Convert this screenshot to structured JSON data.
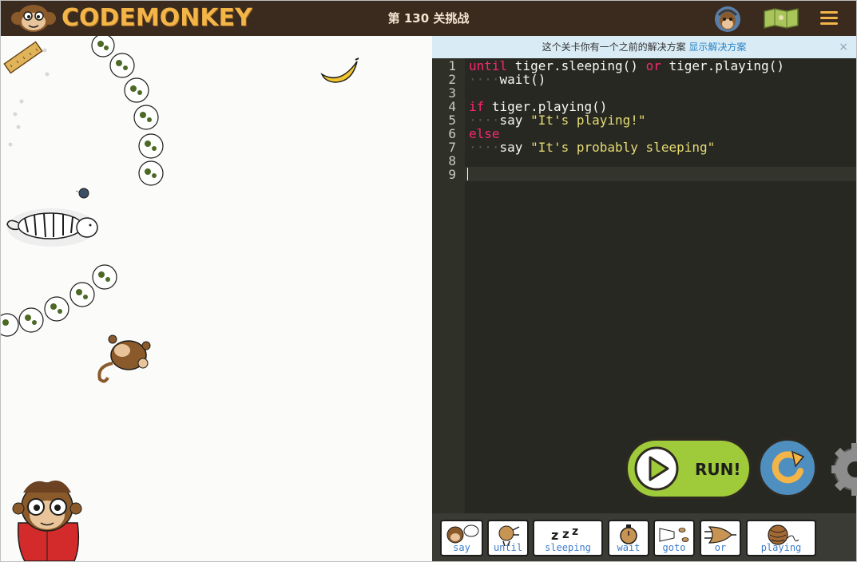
{
  "header": {
    "logo_text": "CODEMONKEY",
    "level_title": "第 130 关挑战"
  },
  "notice": {
    "text": "这个关卡你有一个之前的解决方案",
    "link": "显示解决方案",
    "close": "×"
  },
  "editor": {
    "line_numbers": [
      "1",
      "2",
      "3",
      "4",
      "5",
      "6",
      "7",
      "8",
      "9"
    ],
    "lines": {
      "l1": {
        "kw1": "until",
        "t1": " tiger.sleeping() ",
        "kw2": "or",
        "t2": " tiger.playing()"
      },
      "l2": {
        "dots": "····",
        "t": "wait()"
      },
      "l4": {
        "kw": "if",
        "t": " tiger.playing()"
      },
      "l5": {
        "dots": "····",
        "t": "say ",
        "str": "\"It's playing!\""
      },
      "l6": {
        "kw": "else"
      },
      "l7": {
        "dots": "····",
        "t": "say ",
        "str": "\"It's probably sleeping\""
      }
    }
  },
  "controls": {
    "run_label": "RUN!"
  },
  "palette": {
    "items": [
      "say",
      "until",
      "sleeping",
      "wait",
      "goto",
      "or",
      "playing"
    ]
  },
  "colors": {
    "header_bg": "#3b2a1e",
    "logo": "#f4b548",
    "run_green": "#9fcb3b",
    "reset_blue": "#4f8fbf",
    "keyword": "#f92672",
    "string": "#e6db74"
  }
}
